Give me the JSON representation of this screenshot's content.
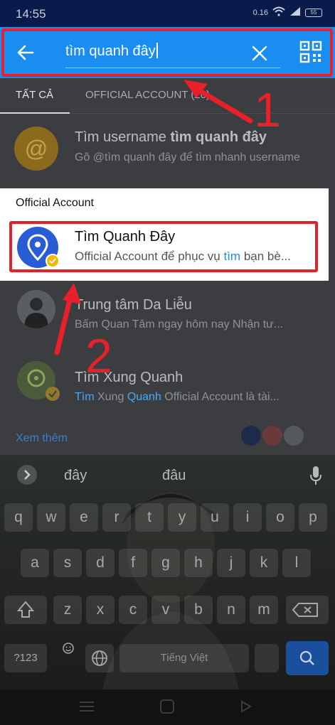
{
  "status_bar": {
    "time": "14:55",
    "speed": "0.16",
    "battery": "55"
  },
  "header": {
    "search_value": "tìm quanh đây",
    "accent_color": "#1a8df0"
  },
  "tabs": [
    {
      "label": "TẤT CẢ"
    },
    {
      "label": "OFFICIAL ACCOUNT (20)"
    }
  ],
  "username_search": {
    "title_prefix": "Tìm username ",
    "title_query": "tìm quanh đây",
    "subtitle": "Gõ @tìm quanh đây để tìm nhanh username"
  },
  "official_section": {
    "header": "Official Account",
    "highlighted_result": {
      "name": "Tìm Quanh Đây",
      "desc_prefix": "Official Account để phục vụ ",
      "desc_highlight": "tìm",
      "desc_suffix": " bạn bè..."
    }
  },
  "results": [
    {
      "name": "Trung tâm Da Liễu",
      "desc": "Bấm Quan Tâm ngay hôm nay Nhận tư..."
    },
    {
      "name": "Tìm Xung Quanh",
      "desc_hl1": "Tìm",
      "desc_mid": " Xung ",
      "desc_hl2": "Quanh",
      "desc_rest": " Official Account là tài..."
    }
  ],
  "see_more": "Xem thêm",
  "keyboard": {
    "suggestions": [
      "đây",
      "đâu"
    ],
    "row1": [
      "q",
      "w",
      "e",
      "r",
      "t",
      "y",
      "u",
      "i",
      "o",
      "p"
    ],
    "row2": [
      "a",
      "s",
      "d",
      "f",
      "g",
      "h",
      "j",
      "k",
      "l"
    ],
    "row3": [
      "z",
      "x",
      "c",
      "v",
      "b",
      "n",
      "m"
    ],
    "numbers_key": "?123",
    "space_label": "Tiếng Việt"
  },
  "annotations": {
    "label_1": "1",
    "label_2": "2",
    "color": "#e8202a"
  }
}
